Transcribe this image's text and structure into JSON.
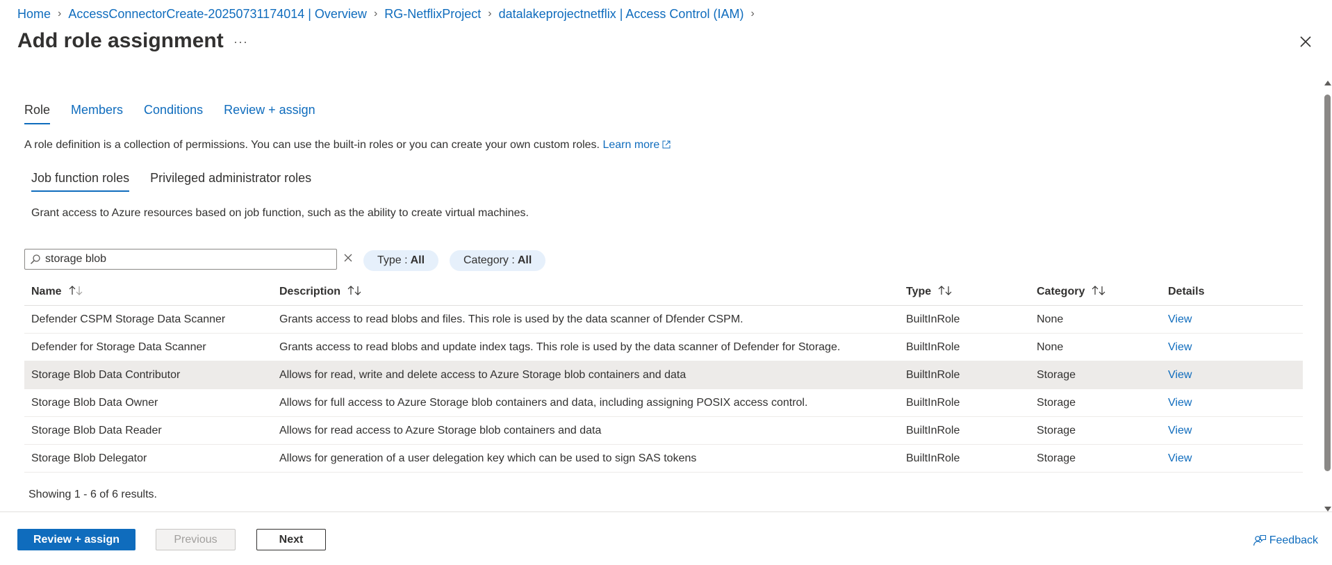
{
  "breadcrumb": [
    {
      "label": "Home"
    },
    {
      "label": "AccessConnectorCreate-20250731174014 | Overview"
    },
    {
      "label": "RG-NetflixProject"
    },
    {
      "label": "datalakeprojectnetflix | Access Control (IAM)"
    }
  ],
  "page": {
    "title": "Add role assignment",
    "more": "···"
  },
  "tabs": [
    {
      "label": "Role"
    },
    {
      "label": "Members"
    },
    {
      "label": "Conditions"
    },
    {
      "label": "Review + assign"
    }
  ],
  "intro": {
    "text": "A role definition is a collection of permissions. You can use the built-in roles or you can create your own custom roles.",
    "link": "Learn more"
  },
  "subtabs": [
    {
      "label": "Job function roles"
    },
    {
      "label": "Privileged administrator roles"
    }
  ],
  "subintro": "Grant access to Azure resources based on job function, such as the ability to create virtual machines.",
  "search": {
    "value": "storage blob"
  },
  "filters": {
    "type_label": "Type :",
    "type_value": "All",
    "category_label": "Category :",
    "category_value": "All"
  },
  "table": {
    "headers": {
      "name": "Name",
      "description": "Description",
      "type": "Type",
      "category": "Category",
      "details": "Details"
    },
    "rows": [
      {
        "name": "Defender CSPM Storage Data Scanner",
        "description": "Grants access to read blobs and files. This role is used by the data scanner of Dfender CSPM.",
        "type": "BuiltInRole",
        "category": "None",
        "details": "View"
      },
      {
        "name": "Defender for Storage Data Scanner",
        "description": "Grants access to read blobs and update index tags. This role is used by the data scanner of Defender for Storage.",
        "type": "BuiltInRole",
        "category": "None",
        "details": "View"
      },
      {
        "name": "Storage Blob Data Contributor",
        "description": "Allows for read, write and delete access to Azure Storage blob containers and data",
        "type": "BuiltInRole",
        "category": "Storage",
        "details": "View"
      },
      {
        "name": "Storage Blob Data Owner",
        "description": "Allows for full access to Azure Storage blob containers and data, including assigning POSIX access control.",
        "type": "BuiltInRole",
        "category": "Storage",
        "details": "View"
      },
      {
        "name": "Storage Blob Data Reader",
        "description": "Allows for read access to Azure Storage blob containers and data",
        "type": "BuiltInRole",
        "category": "Storage",
        "details": "View"
      },
      {
        "name": "Storage Blob Delegator",
        "description": "Allows for generation of a user delegation key which can be used to sign SAS tokens",
        "type": "BuiltInRole",
        "category": "Storage",
        "details": "View"
      }
    ]
  },
  "showing": "Showing 1 - 6 of 6 results.",
  "footer": {
    "review_assign": "Review + assign",
    "previous": "Previous",
    "next": "Next",
    "feedback": "Feedback"
  },
  "colors": {
    "accent": "#0f6cbd",
    "selected_row": "#edebe9",
    "pill_bg": "#e6f0fb"
  }
}
